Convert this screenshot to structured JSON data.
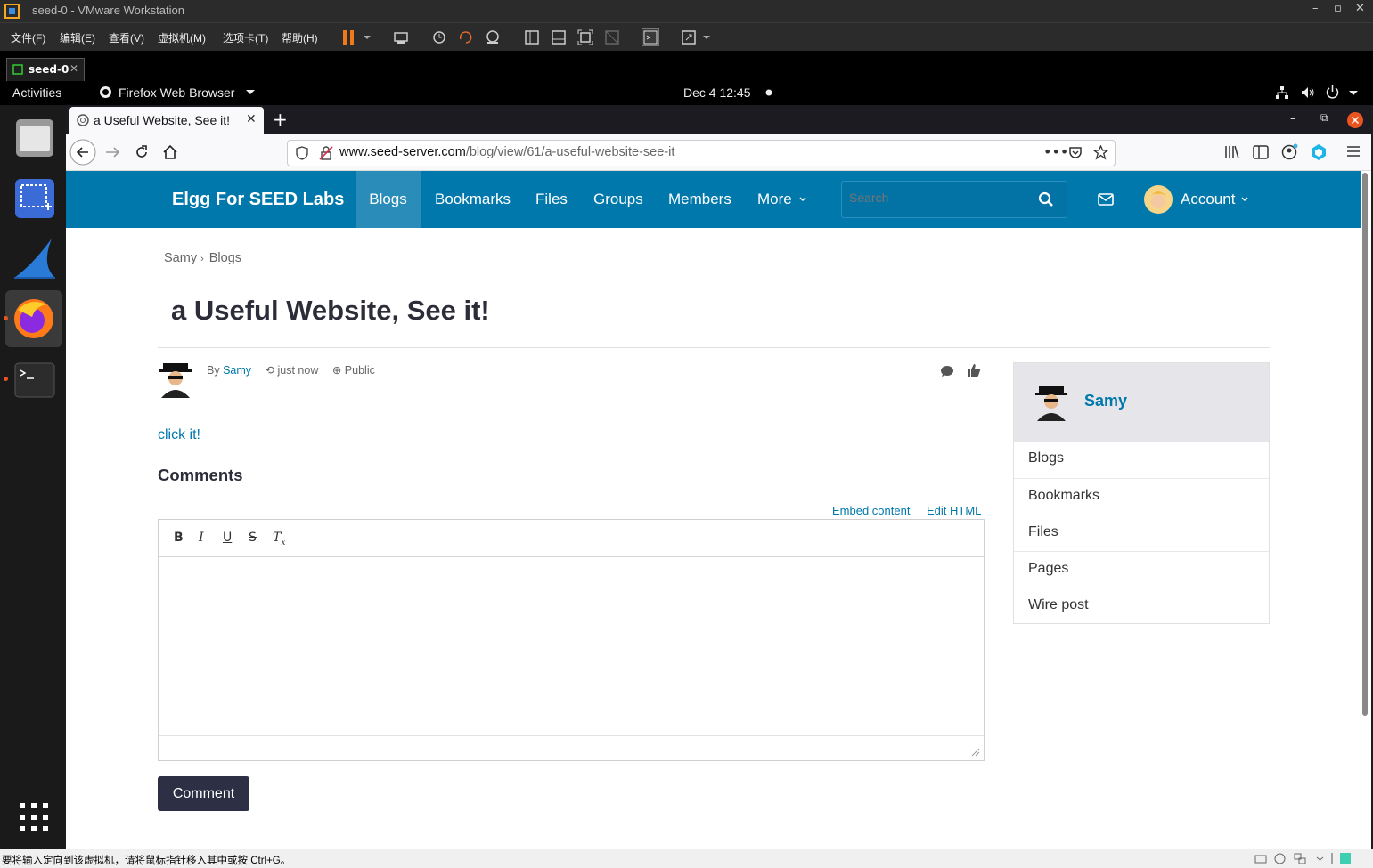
{
  "vmware": {
    "title": "seed-0 - VMware Workstation",
    "menu": [
      "文件(F)",
      "编辑(E)",
      "查看(V)",
      "虚拟机(M)",
      "选项卡(T)",
      "帮助(H)"
    ],
    "tab_label": "seed-0",
    "status_text": "要将输入定向到该虚拟机，请将鼠标指针移入其中或按 Ctrl+G。"
  },
  "gnome": {
    "activities": "Activities",
    "app": "Firefox Web Browser",
    "clock": "Dec 4  12:45"
  },
  "firefox": {
    "tab_title": "a Useful Website, See it!",
    "url_domain": "www.seed-server.com",
    "url_path": "/blog/view/61/a-useful-website-see-it"
  },
  "elgg": {
    "site_name": "Elgg For SEED Labs",
    "nav": [
      "Blogs",
      "Bookmarks",
      "Files",
      "Groups",
      "Members",
      "More"
    ],
    "search_placeholder": "Search",
    "account": "Account",
    "breadcrumb": [
      "Samy",
      "Blogs"
    ],
    "post_title": "a Useful Website, See it!",
    "by": "By",
    "author": "Samy",
    "time": "just now",
    "access": "Public",
    "body_link": "click it!",
    "comments_heading": "Comments",
    "embed_content": "Embed content",
    "edit_html": "Edit HTML",
    "comment_button": "Comment",
    "sidebar_owner": "Samy",
    "sidebar_links": [
      "Blogs",
      "Bookmarks",
      "Files",
      "Pages",
      "Wire post"
    ]
  },
  "colors": {
    "elgg_blue": "#0078ac",
    "link": "#0078ac",
    "button_dark": "#2d2f45"
  }
}
